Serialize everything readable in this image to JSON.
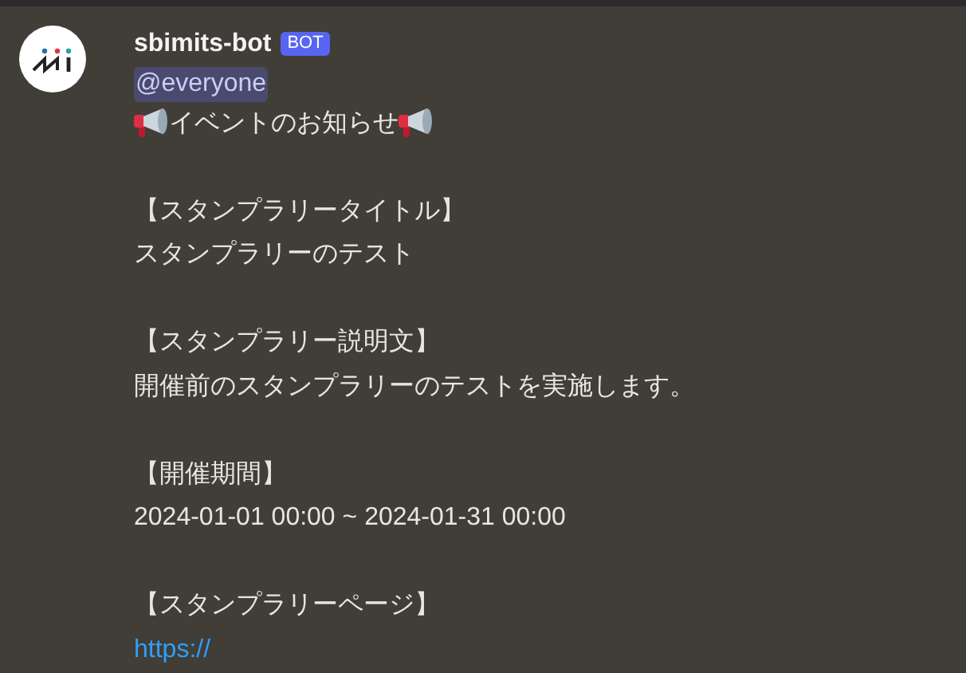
{
  "message": {
    "author": "sbimits-bot",
    "badge": "BOT",
    "mention": "@everyone",
    "lines": [
      {
        "kind": "announcement",
        "text": "イベントのお知らせ"
      },
      {
        "kind": "blank"
      },
      {
        "kind": "text",
        "text": "【スタンプラリータイトル】"
      },
      {
        "kind": "text",
        "text": "スタンプラリーのテスト"
      },
      {
        "kind": "blank"
      },
      {
        "kind": "text",
        "text": "【スタンプラリー説明文】"
      },
      {
        "kind": "text",
        "text": "開催前のスタンプラリーのテストを実施します。"
      },
      {
        "kind": "blank"
      },
      {
        "kind": "text",
        "text": "【開催期間】"
      },
      {
        "kind": "text",
        "text": "2024-01-01 00:00 ~ 2024-01-31 00:00"
      },
      {
        "kind": "blank"
      },
      {
        "kind": "text",
        "text": "【スタンプラリーページ】"
      },
      {
        "kind": "link",
        "text": "https://"
      }
    ]
  }
}
